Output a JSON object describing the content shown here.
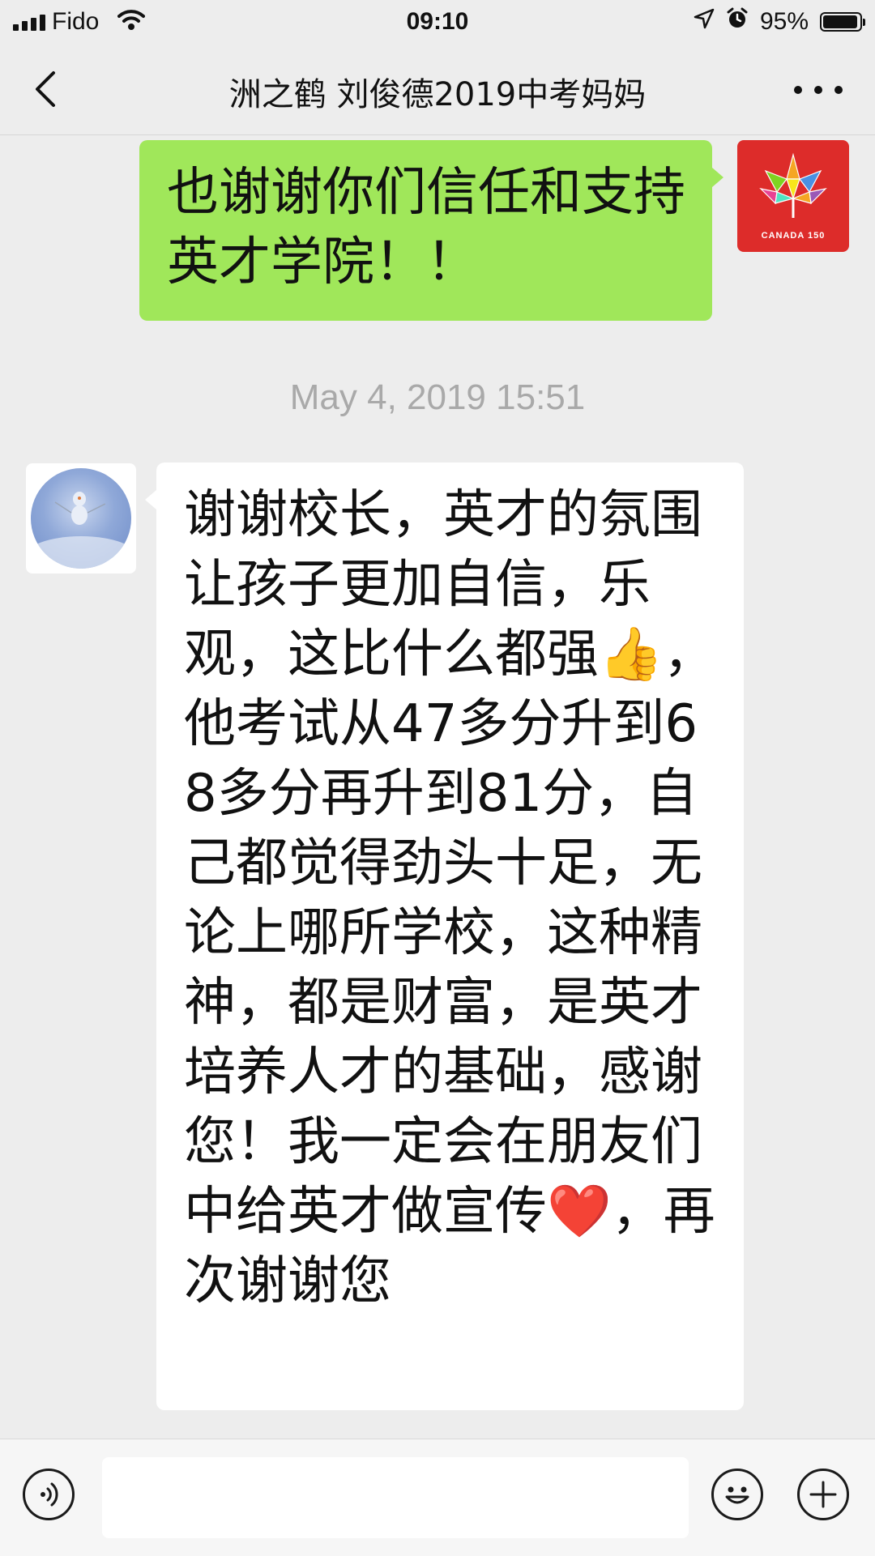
{
  "status_bar": {
    "carrier": "Fido",
    "time": "09:10",
    "battery_percent_label": "95%",
    "battery_level": 0.95,
    "icons": [
      "signal-icon",
      "wifi-icon",
      "location-arrow-icon",
      "alarm-icon",
      "battery-icon"
    ]
  },
  "nav": {
    "title": "洲之鹤 刘俊德2019中考妈妈",
    "back_icon": "chevron-left-icon",
    "more_icon": "more-dots-icon"
  },
  "messages": [
    {
      "direction": "outgoing",
      "text": "也谢谢你们信任和支持英才学院！！",
      "avatar": {
        "type": "canada-150-logo",
        "label": "CANADA 150",
        "color": "#dd2c2a"
      }
    },
    {
      "type": "timestamp",
      "text": "May 4, 2019 15:51"
    },
    {
      "direction": "incoming",
      "avatar": {
        "type": "snowman-photo"
      },
      "text_before_thumb": "谢谢校长，英才的氛围让孩子更加自信，乐观，这比什么都强",
      "emoji_1": "👍",
      "text_middle": "，他考试从47多分升到68多分再升到81分，自己都觉得劲头十足，无论上哪所学校，这种精神，都是财富，是英才培养人才的基础，感谢您！我一定会在朋友们中给英才做宣传",
      "emoji_2": "❤️",
      "text_after": "，再次谢谢您"
    }
  ],
  "input_bar": {
    "value": "",
    "voice_icon": "voice-icon",
    "emoji_icon": "emoji-icon",
    "plus_icon": "plus-icon"
  },
  "colors": {
    "background": "#ededed",
    "outgoing_bubble": "#a0e75a",
    "incoming_bubble": "#ffffff",
    "timestamp_text": "#a9a9a9"
  }
}
